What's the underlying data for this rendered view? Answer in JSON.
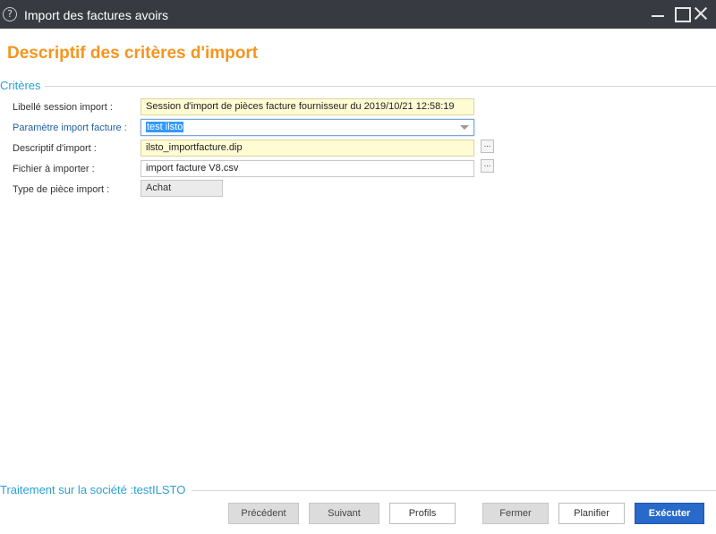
{
  "window": {
    "title": "Import des factures avoirs",
    "help_icon_glyph": "?",
    "icons": [
      "help-icon",
      "minimize-icon",
      "maximize-icon",
      "close-icon"
    ]
  },
  "page": {
    "title": "Descriptif des critères d'import"
  },
  "criteria": {
    "section_label": "Critères",
    "libelle_session": {
      "label": "Libellé session import :",
      "value": "Session d'import de pièces facture fournisseur du 2019/10/21 12:58:19"
    },
    "parametre_import": {
      "label": "Paramètre import facture :",
      "value": "test ilsto"
    },
    "descriptif_import": {
      "label": "Descriptif d'import :",
      "value": "ilsto_importfacture.dip",
      "browse_label": "..."
    },
    "fichier_importer": {
      "label": "Fichier à importer :",
      "value": "import facture V8.csv",
      "browse_label": "..."
    },
    "type_piece": {
      "label": "Type de pièce import :",
      "value": "Achat"
    }
  },
  "footer": {
    "company_label": "Traitement sur la société :testILSTO",
    "buttons": {
      "precedent": "Précédent",
      "suivant": "Suivant",
      "profils": "Profils",
      "fermer": "Fermer",
      "planifier": "Planifier",
      "executer": "Exécuter"
    }
  },
  "colors": {
    "titlebar": "#373b41",
    "heading_orange": "#f7941d",
    "section_blue": "#2aa0d4",
    "primary_button": "#2869c9",
    "input_yellow": "#fffcd4"
  }
}
